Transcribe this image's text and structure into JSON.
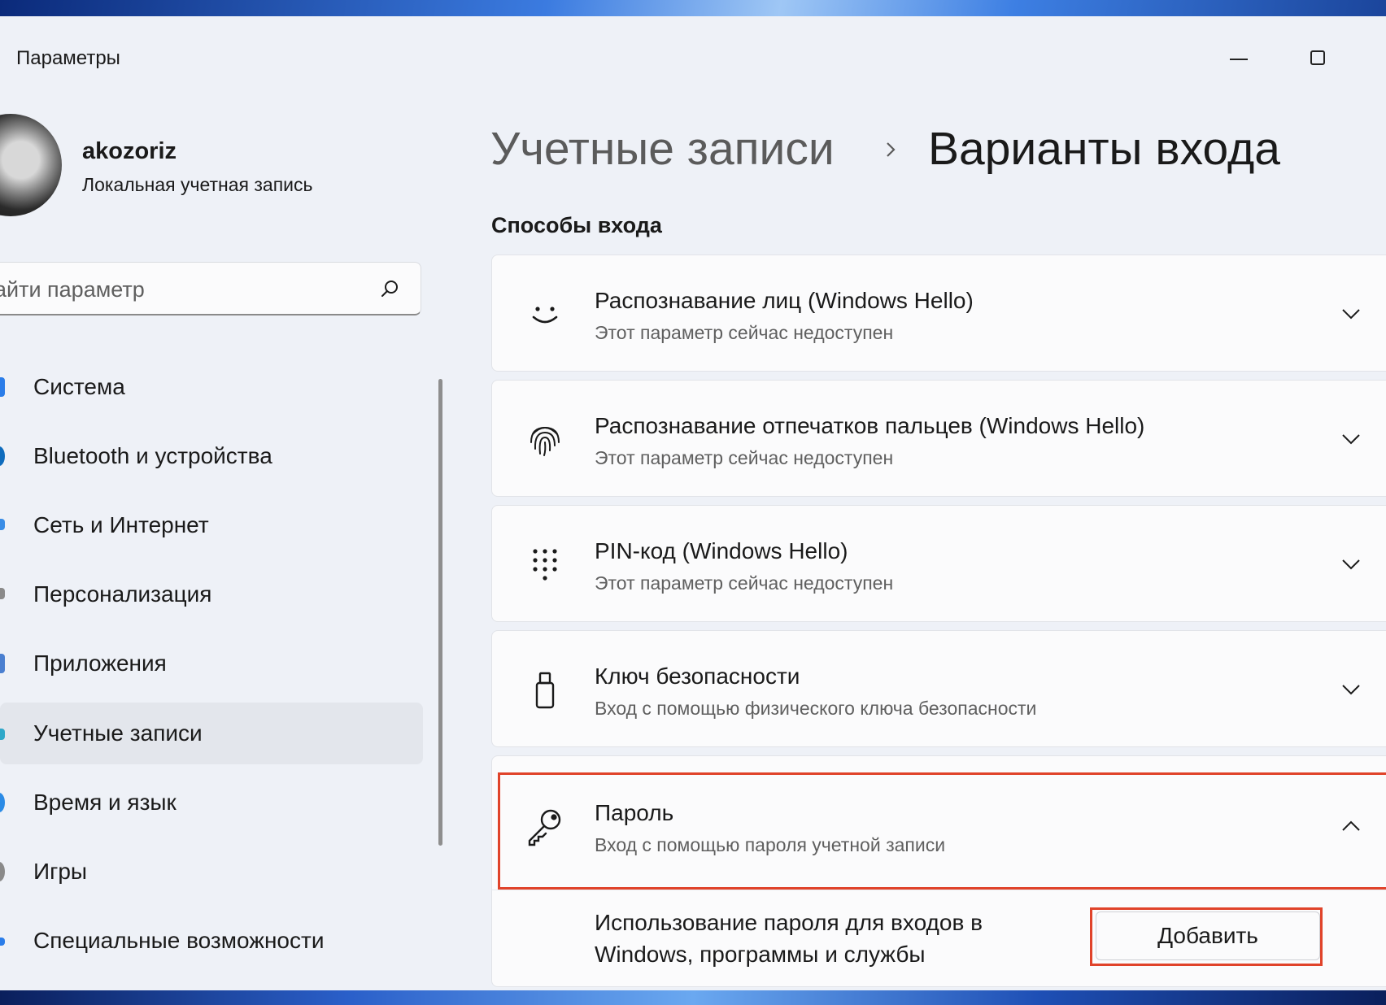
{
  "window": {
    "title": "Параметры"
  },
  "profile": {
    "name": "akozoriz",
    "account_type": "Локальная учетная запись"
  },
  "search": {
    "placeholder": "айти параметр"
  },
  "sidebar": {
    "items": [
      {
        "label": "Система",
        "icon": "system-icon",
        "color": "#2b7de9"
      },
      {
        "label": "Bluetooth и устройства",
        "icon": "bluetooth-icon",
        "color": "#0f6cbd"
      },
      {
        "label": "Сеть и Интернет",
        "icon": "network-icon",
        "color": "#3a8de6"
      },
      {
        "label": "Персонализация",
        "icon": "brush-icon",
        "color": "#8a8a8a"
      },
      {
        "label": "Приложения",
        "icon": "apps-icon",
        "color": "#4a7fd0"
      },
      {
        "label": "Учетные записи",
        "icon": "accounts-icon",
        "color": "#2fa8c9",
        "selected": true
      },
      {
        "label": "Время и язык",
        "icon": "globe-icon",
        "color": "#2b8be6"
      },
      {
        "label": "Игры",
        "icon": "gamepad-icon",
        "color": "#8a8a8a"
      },
      {
        "label": "Специальные возможности",
        "icon": "accessibility-icon",
        "color": "#2b7de9"
      }
    ]
  },
  "header": {
    "parent": "Учетные записи",
    "separator_icon": "chevron-right-icon",
    "current": "Варианты входа"
  },
  "section": {
    "title": "Способы входа"
  },
  "signin_options": [
    {
      "title": "Распознавание лиц (Windows Hello)",
      "subtitle": "Этот параметр сейчас недоступен",
      "icon": "face-icon",
      "expanded": false
    },
    {
      "title": "Распознавание отпечатков пальцев (Windows Hello)",
      "subtitle": "Этот параметр сейчас недоступен",
      "icon": "fingerprint-icon",
      "expanded": false
    },
    {
      "title": "PIN-код (Windows Hello)",
      "subtitle": "Этот параметр сейчас недоступен",
      "icon": "pin-keypad-icon",
      "expanded": false
    },
    {
      "title": "Ключ безопасности",
      "subtitle": "Вход с помощью физического ключа безопасности",
      "icon": "usb-key-icon",
      "expanded": false
    },
    {
      "title": "Пароль",
      "subtitle": "Вход с помощью пароля учетной записи",
      "icon": "key-icon",
      "expanded": true
    }
  ],
  "password_panel": {
    "description": "Использование пароля для входов в Windows, программы и службы",
    "button_label": "Добавить"
  },
  "colors": {
    "accent": "#0f6cbd",
    "highlight": "#e0432a",
    "window_bg": "#eef1f7",
    "card_bg": "#fbfbfc"
  }
}
